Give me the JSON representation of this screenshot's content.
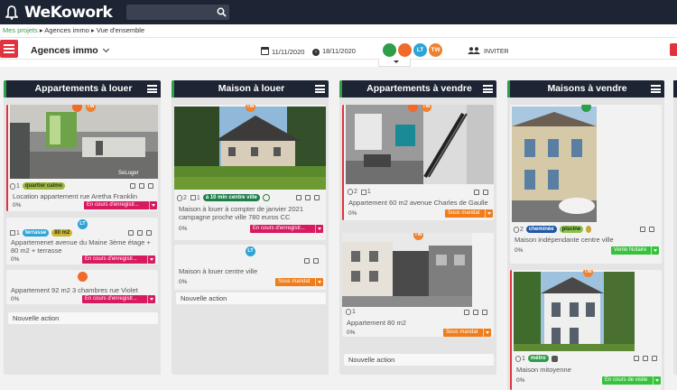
{
  "app": {
    "logo": "WeKowork"
  },
  "search": {
    "placeholder": ""
  },
  "breadcrumb": {
    "items": [
      "Mes projets",
      "Agences immo",
      "Vue d'ensemble"
    ]
  },
  "toolbar": {
    "board_title": "Agences immo",
    "date_start": "11/11/2020",
    "date_end": "18/11/2020",
    "members": [
      "",
      "",
      "LT",
      "TW"
    ],
    "invite_label": "INVITER"
  },
  "columns": [
    {
      "title": "Appartements à louer",
      "cards": [
        {
          "attachments": "1",
          "tags": [
            "quartier calme"
          ],
          "title": "Location appartement rue Aretha Franklin",
          "pct": "0%",
          "status": "En cours d'enregistr...",
          "avatars": [
            "",
            "TW"
          ],
          "watermark": "SeLoger"
        },
        {
          "checklist": "1",
          "tags": [
            "terrasse",
            "80 m2"
          ],
          "title": "Appartemenet avenue du Maine 3ème étage + 80 m2 + terrasse",
          "pct": "0%",
          "status": "En cours d'enregistr...",
          "avatars": [
            "LT"
          ]
        },
        {
          "title": "Appartement 92 m2 3 chambres rue Violet",
          "pct": "0%",
          "status": "En cours d'enregistr...",
          "avatars": [
            ""
          ]
        }
      ],
      "new_action": "Nouvelle action"
    },
    {
      "title": "Maison à louer",
      "cards": [
        {
          "attachments": "2",
          "checklist": "1",
          "tags": [
            "à 10 min centre ville"
          ],
          "title": "Maison à louer à compter de janvier 2021 campagne proche ville 780 euros CC",
          "pct": "0%",
          "status": "En cours d'enregistr...",
          "avatars": [
            "TW"
          ]
        },
        {
          "title": "Maison à louer centre ville",
          "pct": "0%",
          "status": "Sous mandat",
          "avatars": [
            "LT"
          ]
        }
      ],
      "new_action": "Nouvelle action"
    },
    {
      "title": "Appartements à vendre",
      "cards": [
        {
          "attachments": "2",
          "checklist": "1",
          "title": "Appartement 60 m2 avenue Charles de Gaulle",
          "pct": "0%",
          "status": "Sous mandat",
          "avatars": [
            "",
            "TW"
          ]
        },
        {
          "attachments": "1",
          "title": "Appartement 80 m2",
          "pct": "0%",
          "status": "Sous mandat",
          "avatars": [
            "TW"
          ]
        }
      ],
      "new_action": "Nouvelle action"
    },
    {
      "title": "Maisons à vendre",
      "cards": [
        {
          "attachments": "2",
          "tags": [
            "cheminée",
            "piscine"
          ],
          "title": "Maison indépendante centre ville",
          "pct": "0%",
          "status": "Vente Notaire",
          "avatars": [
            ""
          ]
        },
        {
          "attachments": "1",
          "tags": [
            "métro"
          ],
          "title": "Maison mitoyenne",
          "pct": "0%",
          "status": "En cours de visite",
          "avatars": [
            "TW"
          ]
        }
      ]
    }
  ],
  "colors": {
    "topbar": "#1d2433",
    "accent_red": "#e0333d",
    "status_pink": "#d81b60",
    "status_orange": "#ef7d1a",
    "status_green": "#37c23c",
    "column_accent": "#2e9e4a"
  }
}
